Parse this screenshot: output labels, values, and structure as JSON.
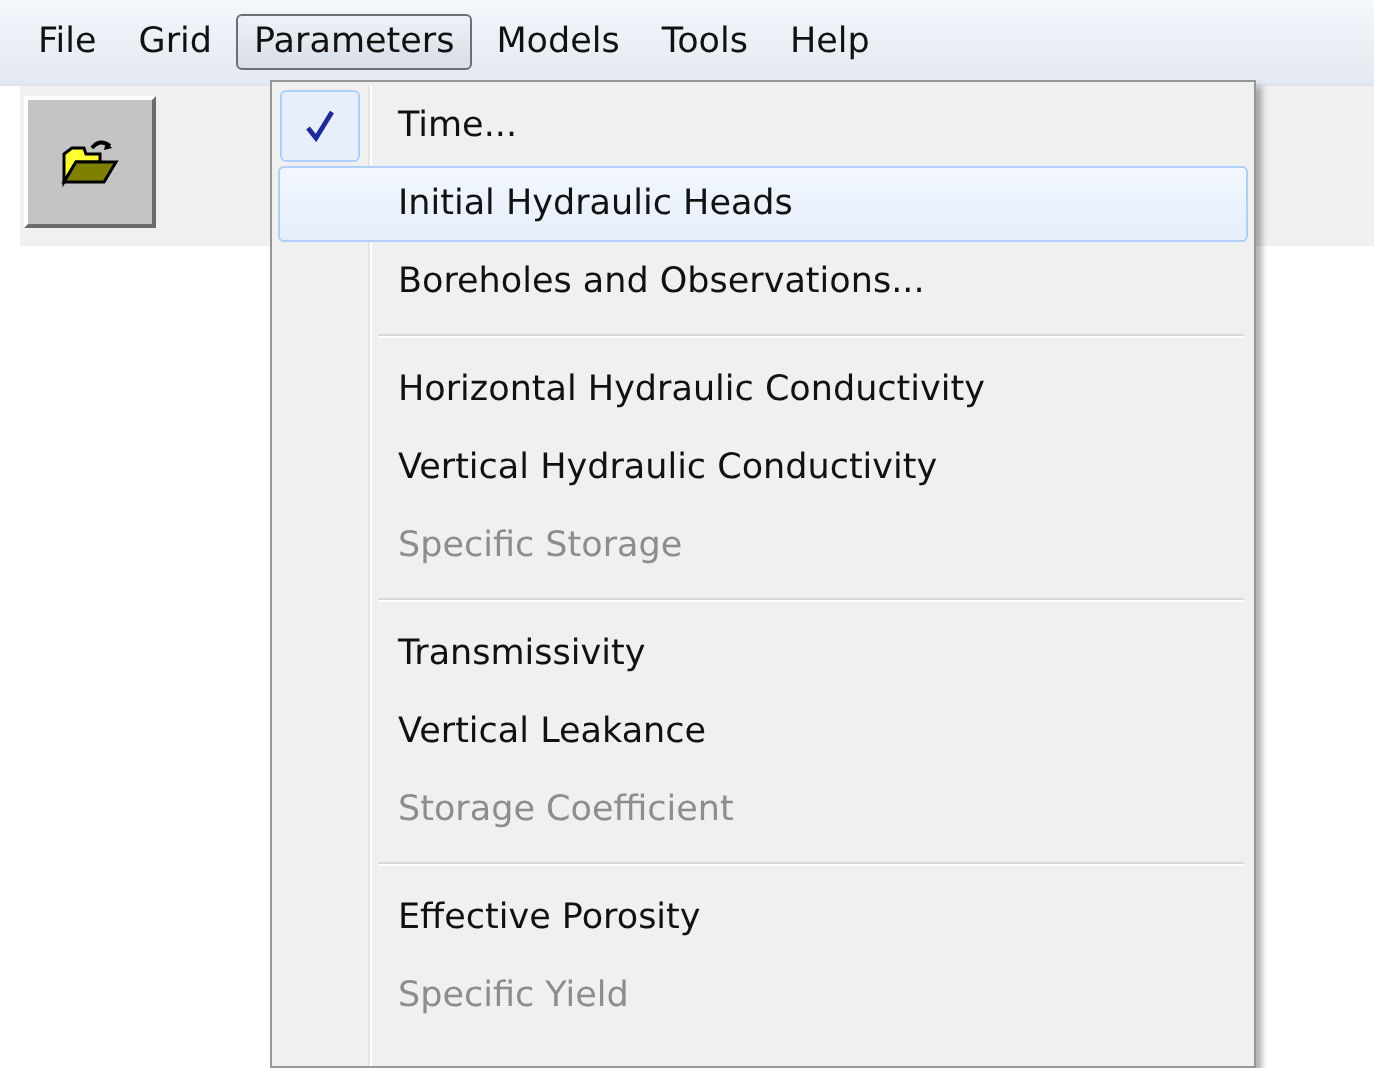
{
  "menu_bar": [
    {
      "label": "File",
      "selected": false
    },
    {
      "label": "Grid",
      "selected": false
    },
    {
      "label": "Parameters",
      "selected": true
    },
    {
      "label": "Models",
      "selected": false
    },
    {
      "label": "Tools",
      "selected": false
    },
    {
      "label": "Help",
      "selected": false
    }
  ],
  "toolbar": {
    "buttons": [
      {
        "kind": "open"
      }
    ]
  },
  "dropdown_menu": {
    "groups": [
      {
        "items": [
          {
            "label": "Time...",
            "checked": true,
            "selected": false,
            "disabled": false
          },
          {
            "label": "Initial Hydraulic Heads",
            "checked": false,
            "selected": true,
            "disabled": false
          },
          {
            "label": "Boreholes and Observations...",
            "checked": false,
            "selected": false,
            "disabled": false
          }
        ]
      },
      {
        "items": [
          {
            "label": "Horizontal Hydraulic Conductivity",
            "checked": false,
            "selected": false,
            "disabled": false
          },
          {
            "label": "Vertical Hydraulic Conductivity",
            "checked": false,
            "selected": false,
            "disabled": false
          },
          {
            "label": "Specific Storage",
            "checked": false,
            "selected": false,
            "disabled": true
          }
        ]
      },
      {
        "items": [
          {
            "label": "Transmissivity",
            "checked": false,
            "selected": false,
            "disabled": false
          },
          {
            "label": "Vertical Leakance",
            "checked": false,
            "selected": false,
            "disabled": false
          },
          {
            "label": "Storage Coefficient",
            "checked": false,
            "selected": false,
            "disabled": true
          }
        ]
      },
      {
        "items": [
          {
            "label": "Effective Porosity",
            "checked": false,
            "selected": false,
            "disabled": false
          },
          {
            "label": "Specific Yield",
            "checked": false,
            "selected": false,
            "disabled": true
          }
        ]
      }
    ]
  }
}
